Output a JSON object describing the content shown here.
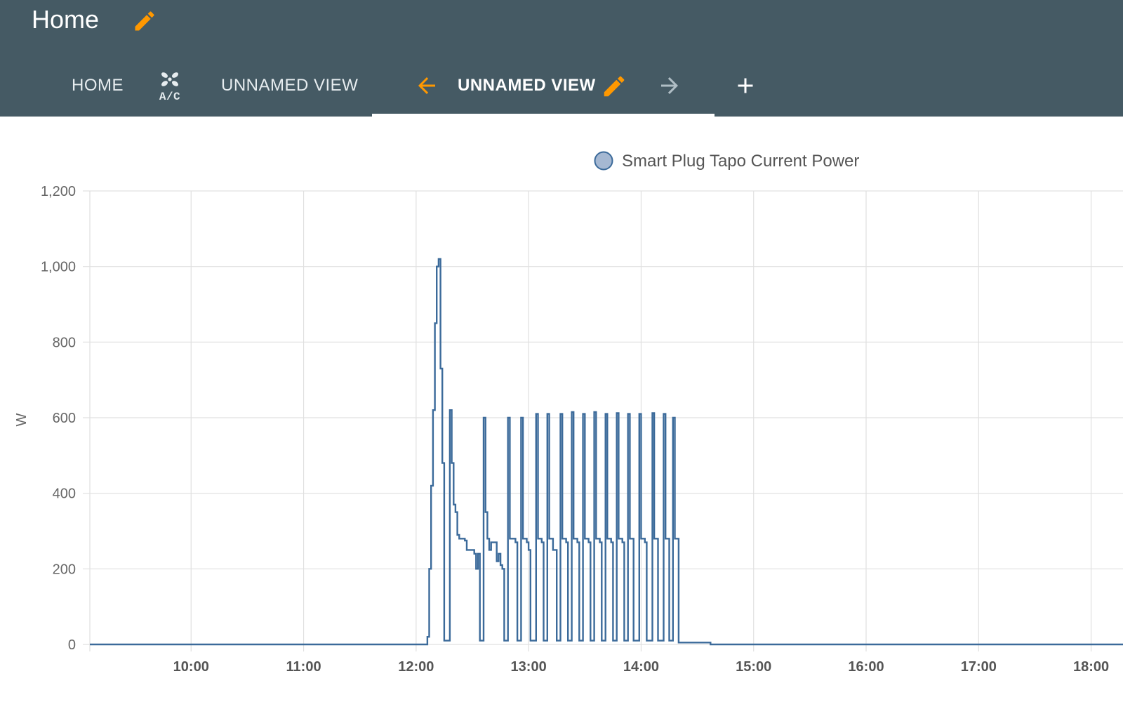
{
  "header": {
    "title": "Home",
    "tabs": [
      {
        "label": "HOME"
      },
      {
        "icon": "fan-ac-icon",
        "label": "A/C"
      },
      {
        "label": "UNNAMED VIEW"
      },
      {
        "label": "UNNAMED VIEW",
        "active": true
      }
    ]
  },
  "colors": {
    "header_bg": "#455a64",
    "accent": "#ff9800",
    "series_line": "#3b6a9a",
    "legend_fill": "#a5b8d2"
  },
  "icons": [
    "pencil-icon",
    "fan-ac-icon",
    "arrow-left-icon",
    "arrow-right-icon",
    "plus-icon"
  ],
  "chart_data": {
    "type": "line",
    "step": true,
    "title": "",
    "xlabel": "",
    "ylabel": "W",
    "legend": {
      "position": "top-center",
      "entries": [
        "Smart Plug Tapo Current Power"
      ]
    },
    "grid": true,
    "ylim": [
      0,
      1200
    ],
    "yticks": [
      0,
      200,
      400,
      600,
      800,
      1000,
      1200
    ],
    "ytick_labels": [
      "0",
      "200",
      "400",
      "600",
      "800",
      "1,000",
      "1,200"
    ],
    "xlim": [
      "09:06",
      "18:17"
    ],
    "xticks": [
      "10:00",
      "11:00",
      "12:00",
      "13:00",
      "14:00",
      "15:00",
      "16:00",
      "17:00",
      "18:00"
    ],
    "series": [
      {
        "name": "Smart Plug Tapo Current Power",
        "points": [
          [
            "09:06",
            0
          ],
          [
            "12:05",
            0
          ],
          [
            "12:06",
            20
          ],
          [
            "12:07",
            200
          ],
          [
            "12:08",
            420
          ],
          [
            "12:09",
            620
          ],
          [
            "12:10",
            850
          ],
          [
            "12:11",
            1000
          ],
          [
            "12:12",
            1020
          ],
          [
            "12:13",
            730
          ],
          [
            "12:14",
            480
          ],
          [
            "12:15",
            10
          ],
          [
            "12:17",
            10
          ],
          [
            "12:18",
            620
          ],
          [
            "12:19",
            480
          ],
          [
            "12:20",
            370
          ],
          [
            "12:21",
            350
          ],
          [
            "12:22",
            290
          ],
          [
            "12:23",
            280
          ],
          [
            "12:26",
            275
          ],
          [
            "12:27",
            250
          ],
          [
            "12:31",
            240
          ],
          [
            "12:32",
            200
          ],
          [
            "12:33",
            240
          ],
          [
            "12:34",
            10
          ],
          [
            "12:36",
            600
          ],
          [
            "12:37",
            350
          ],
          [
            "12:38",
            280
          ],
          [
            "12:39",
            250
          ],
          [
            "12:40",
            270
          ],
          [
            "12:43",
            220
          ],
          [
            "12:44",
            240
          ],
          [
            "12:45",
            210
          ],
          [
            "12:46",
            200
          ],
          [
            "12:47",
            10
          ],
          [
            "12:49",
            600
          ],
          [
            "12:50",
            280
          ],
          [
            "12:53",
            270
          ],
          [
            "12:54",
            10
          ],
          [
            "12:56",
            600
          ],
          [
            "12:57",
            280
          ],
          [
            "12:59",
            270
          ],
          [
            "13:00",
            250
          ],
          [
            "13:01",
            10
          ],
          [
            "13:04",
            610
          ],
          [
            "13:05",
            280
          ],
          [
            "13:07",
            270
          ],
          [
            "13:08",
            10
          ],
          [
            "13:10",
            610
          ],
          [
            "13:11",
            280
          ],
          [
            "13:13",
            250
          ],
          [
            "13:15",
            10
          ],
          [
            "13:17",
            610
          ],
          [
            "13:18",
            280
          ],
          [
            "13:20",
            270
          ],
          [
            "13:21",
            10
          ],
          [
            "13:23",
            615
          ],
          [
            "13:24",
            280
          ],
          [
            "13:26",
            270
          ],
          [
            "13:27",
            10
          ],
          [
            "13:29",
            610
          ],
          [
            "13:30",
            280
          ],
          [
            "13:32",
            270
          ],
          [
            "13:33",
            10
          ],
          [
            "13:35",
            615
          ],
          [
            "13:36",
            280
          ],
          [
            "13:38",
            270
          ],
          [
            "13:39",
            10
          ],
          [
            "13:41",
            610
          ],
          [
            "13:42",
            280
          ],
          [
            "13:44",
            270
          ],
          [
            "13:45",
            10
          ],
          [
            "13:47",
            612
          ],
          [
            "13:48",
            280
          ],
          [
            "13:50",
            270
          ],
          [
            "13:51",
            10
          ],
          [
            "13:53",
            610
          ],
          [
            "13:54",
            280
          ],
          [
            "13:56",
            10
          ],
          [
            "13:59",
            610
          ],
          [
            "14:00",
            280
          ],
          [
            "14:02",
            270
          ],
          [
            "14:03",
            10
          ],
          [
            "14:06",
            612
          ],
          [
            "14:07",
            280
          ],
          [
            "14:09",
            10
          ],
          [
            "14:12",
            610
          ],
          [
            "14:13",
            280
          ],
          [
            "14:15",
            10
          ],
          [
            "14:17",
            600
          ],
          [
            "14:18",
            280
          ],
          [
            "14:20",
            5
          ],
          [
            "14:37",
            0
          ],
          [
            "18:17",
            0
          ]
        ]
      }
    ]
  }
}
